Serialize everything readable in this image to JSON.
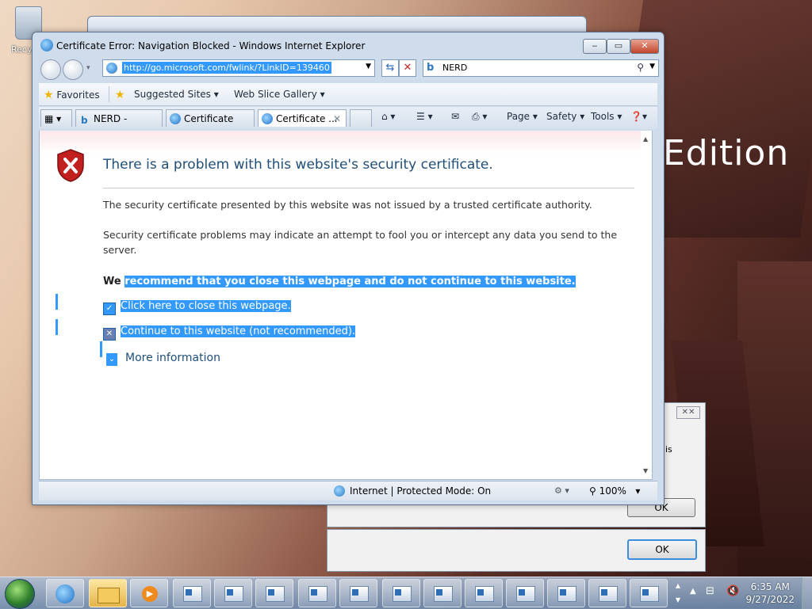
{
  "desktop": {
    "recycle_bin_label": "Recycle Bin",
    "wallpaper_text": "Edition"
  },
  "window": {
    "title": "Certificate Error: Navigation Blocked - Windows Internet Explorer",
    "btn_minimize": "‒",
    "btn_maximize": "▭",
    "btn_close": "✕"
  },
  "navigation": {
    "address_url": "http://go.microsoft.com/fwlink/?LinkID=139460",
    "search_value": "NERD"
  },
  "favorites_bar": {
    "favorites_label": "Favorites",
    "suggested_sites_label": "Suggested Sites",
    "web_slice_gallery_label": "Web Slice Gallery"
  },
  "tabs": [
    {
      "label": "NERD - Search"
    },
    {
      "label": "Certificate Err..."
    },
    {
      "label": "Certificate ..."
    }
  ],
  "command_bar": {
    "page_label": "Page",
    "safety_label": "Safety",
    "tools_label": "Tools"
  },
  "page": {
    "heading": "There is a problem with this website's security certificate.",
    "para1": "The security certificate presented by this website was not issued by a trusted certificate authority.",
    "para2": "Security certificate problems may indicate an attempt to fool you or intercept any data you send to the server.",
    "recommend_we": "We",
    "recommend_rest": "recommend that you close this webpage and do not continue to this website.",
    "close_link": "Click here to close this webpage.",
    "continue_link": "Continue to this website (not recommended).",
    "more_info": "More information"
  },
  "statusbar": {
    "zone": "Internet | Protected Mode: On",
    "zoom": "100%"
  },
  "dialogs": {
    "ok_label": "OK",
    "fragment_text": "is"
  },
  "taskbar": {
    "time": "6:35 AM",
    "date": "9/27/2022"
  },
  "colors": {
    "selection": "#3399ff",
    "heading": "#1f4e79"
  }
}
